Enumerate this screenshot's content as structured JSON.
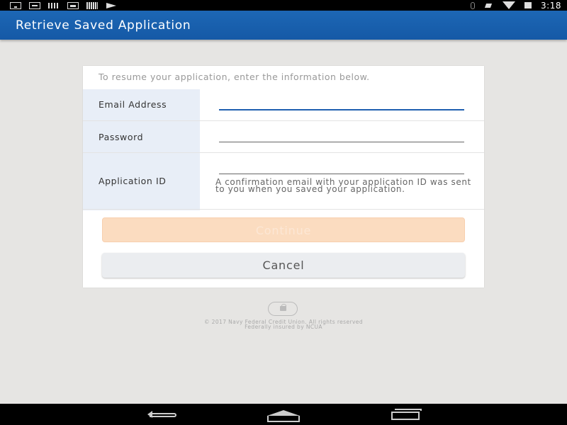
{
  "status_bar": {
    "time": "3:18",
    "left_icons": [
      "download-icon",
      "email-icon",
      "wifi-setup-icon",
      "media-icon",
      "barcode-icon",
      "plane-icon"
    ],
    "right_icons": [
      "bluetooth-icon",
      "mute-icon",
      "wifi-icon",
      "battery-icon"
    ]
  },
  "app_bar": {
    "title": "Retrieve Saved Application",
    "color": "#1a62b0"
  },
  "form": {
    "instructions": "To resume your application, enter the information below.",
    "fields": [
      {
        "label": "Email Address",
        "value": "",
        "placeholder": ""
      },
      {
        "label": "Password",
        "value": "",
        "placeholder": ""
      },
      {
        "label": "Application ID",
        "value": "",
        "placeholder": ""
      }
    ],
    "application_id_helper": "A confirmation email with your application ID was sent to you when you saved your application.",
    "continue_label": "Continue",
    "cancel_label": "Cancel"
  },
  "footer": {
    "copyright": "© 2017 Navy Federal Credit Union. All rights reserved",
    "insured": "Federally insured by NCUA"
  },
  "nav_bar": {
    "buttons": [
      "back-icon",
      "home-icon",
      "recent-apps-icon"
    ]
  },
  "colors": {
    "accent": "#1f5fb0",
    "continue_disabled": "#fbdcc0",
    "label_column": "#e8eef7",
    "background": "#e6e5e3"
  }
}
